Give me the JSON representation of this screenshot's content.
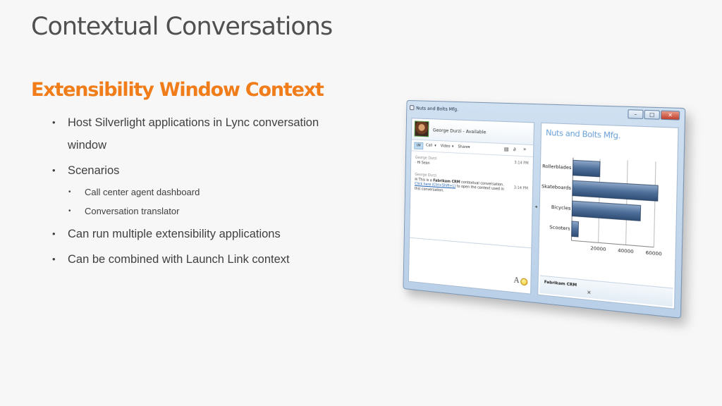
{
  "slide": {
    "title": "Contextual Conversations",
    "subtitle": "Extensibility Window Context",
    "bullets": [
      {
        "level": 1,
        "text": "Host Silverlight applications in Lync conversation window"
      },
      {
        "level": 1,
        "text": "Scenarios"
      },
      {
        "level": 2,
        "text": "Call center agent dashboard"
      },
      {
        "level": 2,
        "text": "Conversation translator"
      },
      {
        "level": 1,
        "text": "Can run multiple extensibility applications"
      },
      {
        "level": 1,
        "text": "Can be combined with Launch Link context"
      }
    ]
  },
  "window": {
    "title": "Nuts and Bolts Mfg.",
    "contact_status": "George Durzi - Available",
    "toolbar": {
      "im": "IM",
      "call": "Call",
      "video": "Video",
      "share": "Share"
    },
    "messages": [
      {
        "sender": "George Durzi",
        "time": "3:14 PM",
        "text": "Hi Sean"
      },
      {
        "sender": "George Durzi",
        "time": "3:14 PM",
        "text_pre": "This is a ",
        "brand": "Fabrikam CRM",
        "text_mid": " contextual conversation. ",
        "link": "Click here (Ctrl+Shift+L)",
        "text_post": " to open the context used in this conversation."
      }
    ],
    "font_button": "A",
    "app_title": "Nuts and Bolts Mfg.",
    "tab_label": "Fabrikam CRM",
    "chart_data": {
      "type": "bar",
      "orientation": "horizontal",
      "categories": [
        "Rollerblades",
        "Skateboards",
        "Bicycles",
        "Scooters"
      ],
      "values": [
        20000,
        62000,
        50000,
        5000
      ],
      "xlim": [
        0,
        60000
      ],
      "xticks": [
        "20000",
        "40000",
        "60000"
      ],
      "grid": true,
      "bar_color": "#4e6f9a"
    }
  }
}
